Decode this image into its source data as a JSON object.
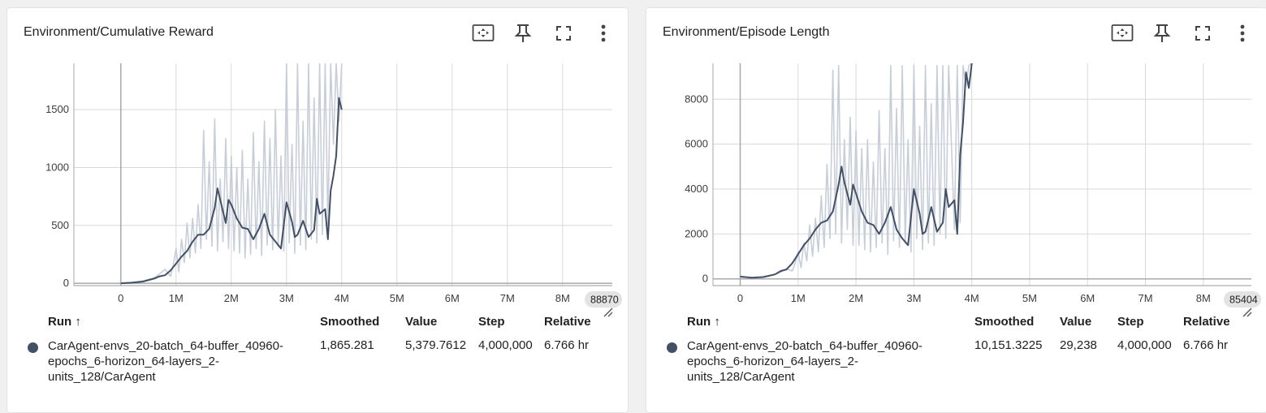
{
  "cards": [
    {
      "title": "Environment/Cumulative Reward",
      "table": {
        "headers": {
          "run": "Run ↑",
          "smoothed": "Smoothed",
          "value": "Value",
          "step": "Step",
          "relative": "Relative"
        },
        "row": {
          "run_lines": [
            "CarAgent-envs_20-batch_64-buffer_40960-",
            "epochs_6-horizon_64-layers_2-",
            "units_128/CarAgent"
          ],
          "smoothed": "1,865.281",
          "value": "5,379.7612",
          "step": "4,000,000",
          "relative": "6.766 hr"
        }
      }
    },
    {
      "title": "Environment/Episode Length",
      "table": {
        "headers": {
          "run": "Run ↑",
          "smoothed": "Smoothed",
          "value": "Value",
          "step": "Step",
          "relative": "Relative"
        },
        "row": {
          "run_lines": [
            "CarAgent-envs_20-batch_64-buffer_40960-",
            "epochs_6-horizon_64-layers_2-",
            "units_128/CarAgent"
          ],
          "smoothed": "10,151.3225",
          "value": "29,238",
          "step": "4,000,000",
          "relative": "6.766 hr"
        }
      }
    }
  ],
  "toolbar_icons": [
    "fit-domain-icon",
    "pin-icon",
    "fullscreen-icon",
    "more-vert-icon"
  ],
  "colors": {
    "smoothed": "#425066",
    "raw": "#c7ced9",
    "grid": "#d8d8d8",
    "axis": "#a8a8a8",
    "dot": "#425066"
  },
  "chart_data": [
    {
      "type": "line",
      "title": "Environment/Cumulative Reward",
      "xlabel": "",
      "ylabel": "",
      "xlim": [
        -850000,
        8900000
      ],
      "ylim": [
        -20,
        1900
      ],
      "x_ticks": [
        0,
        1000000,
        2000000,
        3000000,
        4000000,
        5000000,
        6000000,
        7000000,
        8000000
      ],
      "x_tick_labels": [
        "0",
        "1M",
        "2M",
        "3M",
        "4M",
        "5M",
        "6M",
        "7M",
        "8M"
      ],
      "y_ticks": [
        0,
        500,
        1000,
        1500
      ],
      "y_tick_labels": [
        "0",
        "500",
        "1000",
        "1500"
      ],
      "x_hover_badge": "88870",
      "grid": true,
      "series": [
        {
          "kind": "raw",
          "x": [
            0,
            200000,
            400000,
            600000,
            700000,
            800000,
            900000,
            950000,
            1000000,
            1050000,
            1100000,
            1150000,
            1200000,
            1250000,
            1300000,
            1350000,
            1400000,
            1450000,
            1500000,
            1550000,
            1600000,
            1650000,
            1700000,
            1750000,
            1800000,
            1850000,
            1900000,
            1950000,
            2000000,
            2050000,
            2100000,
            2150000,
            2200000,
            2250000,
            2300000,
            2350000,
            2400000,
            2450000,
            2500000,
            2550000,
            2600000,
            2650000,
            2700000,
            2750000,
            2800000,
            2850000,
            2900000,
            2950000,
            3000000,
            3050000,
            3100000,
            3150000,
            3200000,
            3250000,
            3300000,
            3350000,
            3400000,
            3450000,
            3500000,
            3550000,
            3600000,
            3650000,
            3700000,
            3750000,
            3800000,
            3850000,
            3900000,
            3950000,
            4000000
          ],
          "y": [
            0,
            8,
            20,
            45,
            80,
            120,
            60,
            160,
            300,
            100,
            380,
            180,
            520,
            220,
            560,
            260,
            680,
            300,
            1320,
            380,
            1050,
            320,
            1420,
            280,
            900,
            360,
            1250,
            300,
            1100,
            280,
            1000,
            260,
            1150,
            220,
            900,
            250,
            1300,
            300,
            1050,
            240,
            1400,
            330,
            1250,
            290,
            1500,
            320,
            1100,
            280,
            1900,
            350,
            1200,
            260,
            1900,
            330,
            1400,
            290,
            1900,
            380,
            1600,
            350,
            1900,
            420,
            1900,
            500,
            1900,
            1200,
            1900,
            1400,
            1900
          ]
        },
        {
          "kind": "smoothed",
          "x": [
            0,
            200000,
            400000,
            600000,
            700000,
            800000,
            900000,
            1000000,
            1100000,
            1200000,
            1300000,
            1400000,
            1500000,
            1600000,
            1700000,
            1750000,
            1800000,
            1900000,
            1950000,
            2000000,
            2100000,
            2200000,
            2300000,
            2400000,
            2500000,
            2600000,
            2700000,
            2800000,
            2900000,
            3000000,
            3100000,
            3150000,
            3200000,
            3300000,
            3400000,
            3500000,
            3550000,
            3600000,
            3700000,
            3750000,
            3800000,
            3850000,
            3900000,
            3950000,
            4000000
          ],
          "y": [
            0,
            5,
            15,
            40,
            60,
            70,
            110,
            170,
            230,
            280,
            360,
            420,
            420,
            470,
            650,
            820,
            720,
            520,
            720,
            680,
            560,
            480,
            470,
            380,
            470,
            600,
            420,
            360,
            300,
            700,
            530,
            400,
            420,
            540,
            400,
            460,
            730,
            600,
            640,
            380,
            800,
            930,
            1100,
            1600,
            1500
          ]
        }
      ]
    },
    {
      "type": "line",
      "title": "Environment/Episode Length",
      "xlabel": "",
      "ylabel": "",
      "xlim": [
        -470000,
        8830000
      ],
      "ylim": [
        -300,
        9600
      ],
      "x_ticks": [
        0,
        1000000,
        2000000,
        3000000,
        4000000,
        5000000,
        6000000,
        7000000,
        8000000
      ],
      "x_tick_labels": [
        "0",
        "1M",
        "2M",
        "3M",
        "4M",
        "5M",
        "6M",
        "7M",
        "8M"
      ],
      "y_ticks": [
        0,
        2000,
        4000,
        6000,
        8000
      ],
      "y_tick_labels": [
        "0",
        "2000",
        "4000",
        "6000",
        "8000"
      ],
      "x_hover_badge": "85404",
      "grid": true,
      "series": [
        {
          "kind": "raw",
          "x": [
            0,
            200000,
            400000,
            600000,
            700000,
            800000,
            900000,
            950000,
            1000000,
            1050000,
            1100000,
            1150000,
            1200000,
            1250000,
            1300000,
            1350000,
            1400000,
            1450000,
            1500000,
            1550000,
            1600000,
            1650000,
            1700000,
            1750000,
            1800000,
            1850000,
            1900000,
            1950000,
            2000000,
            2050000,
            2100000,
            2150000,
            2200000,
            2250000,
            2300000,
            2350000,
            2400000,
            2450000,
            2500000,
            2550000,
            2600000,
            2650000,
            2700000,
            2750000,
            2800000,
            2850000,
            2900000,
            2950000,
            3000000,
            3050000,
            3100000,
            3150000,
            3200000,
            3250000,
            3300000,
            3350000,
            3400000,
            3450000,
            3500000,
            3550000,
            3600000,
            3700000,
            3750000,
            3800000,
            3850000,
            3900000,
            3950000,
            4000000
          ],
          "y": [
            80,
            60,
            100,
            200,
            300,
            450,
            350,
            700,
            1200,
            500,
            1600,
            800,
            2400,
            1000,
            2700,
            1200,
            3700,
            1400,
            5100,
            1800,
            9300,
            2000,
            9500,
            1600,
            6200,
            2200,
            7200,
            1500,
            6600,
            1500,
            5800,
            1300,
            6200,
            1200,
            5200,
            1400,
            7500,
            1600,
            5800,
            1100,
            9500,
            1700,
            7600,
            1400,
            9500,
            1600,
            6200,
            1200,
            9500,
            1800,
            6800,
            1300,
            9500,
            1600,
            7800,
            1500,
            9500,
            2000,
            9500,
            1800,
            9500,
            2200,
            9500,
            2500,
            9500,
            8600,
            9500,
            9600
          ]
        },
        {
          "kind": "smoothed",
          "x": [
            0,
            200000,
            400000,
            600000,
            700000,
            800000,
            900000,
            1000000,
            1100000,
            1200000,
            1300000,
            1400000,
            1500000,
            1600000,
            1700000,
            1750000,
            1800000,
            1900000,
            1950000,
            2000000,
            2100000,
            2200000,
            2300000,
            2400000,
            2500000,
            2600000,
            2700000,
            2800000,
            2900000,
            3000000,
            3100000,
            3150000,
            3200000,
            3300000,
            3400000,
            3500000,
            3550000,
            3600000,
            3700000,
            3750000,
            3800000,
            3850000,
            3900000,
            3950000,
            4000000
          ],
          "y": [
            100,
            50,
            80,
            200,
            350,
            420,
            700,
            1100,
            1500,
            1800,
            2200,
            2500,
            2600,
            3000,
            4200,
            5000,
            4300,
            3300,
            4200,
            3800,
            3000,
            2500,
            2400,
            2000,
            2500,
            3200,
            2200,
            1800,
            1500,
            4000,
            2900,
            2000,
            2100,
            3200,
            2100,
            2500,
            4000,
            3200,
            3500,
            2000,
            5500,
            7000,
            9200,
            8500,
            9600
          ]
        }
      ]
    }
  ]
}
